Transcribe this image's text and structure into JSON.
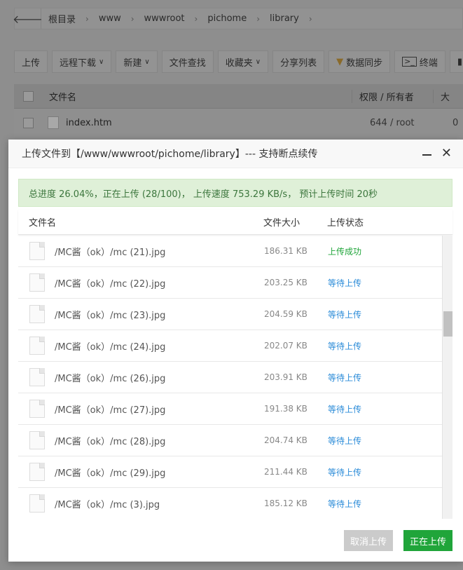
{
  "pathbar": {
    "back_icon": "arrow-left-icon",
    "crumbs": [
      "根目录",
      "www",
      "wwwroot",
      "pichome",
      "library"
    ]
  },
  "toolbar": {
    "upload": "上传",
    "remote_download": "远程下载",
    "new": "新建",
    "file_search": "文件查找",
    "favorites": "收藏夹",
    "share_list": "分享列表",
    "data_sync": "数据同步",
    "terminal": "终端",
    "more": "/"
  },
  "file_table": {
    "headers": {
      "name": "文件名",
      "perm": "权限 / 所有者",
      "size": "大"
    },
    "rows": [
      {
        "name": "index.htm",
        "perm": "644 / root",
        "size": "0"
      }
    ]
  },
  "modal": {
    "title": "上传文件到【/www/wwwroot/pichome/library】--- 支持断点续传",
    "progress": "总进度 26.04%，正在上传 (28/100)，  上传速度 753.29 KB/s，    预计上传时间 20秒",
    "progress_percent": 26.04,
    "headers": {
      "name": "文件名",
      "size": "文件大小",
      "status": "上传状态"
    },
    "files": [
      {
        "name": "/MC酱（ok）/mc (21).jpg",
        "size": "186.31 KB",
        "status": "上传成功",
        "state": "ok"
      },
      {
        "name": "/MC酱（ok）/mc (22).jpg",
        "size": "203.25 KB",
        "status": "等待上传",
        "state": "wait"
      },
      {
        "name": "/MC酱（ok）/mc (23).jpg",
        "size": "204.59 KB",
        "status": "等待上传",
        "state": "wait"
      },
      {
        "name": "/MC酱（ok）/mc (24).jpg",
        "size": "202.07 KB",
        "status": "等待上传",
        "state": "wait"
      },
      {
        "name": "/MC酱（ok）/mc (26).jpg",
        "size": "203.91 KB",
        "status": "等待上传",
        "state": "wait"
      },
      {
        "name": "/MC酱（ok）/mc (27).jpg",
        "size": "191.38 KB",
        "status": "等待上传",
        "state": "wait"
      },
      {
        "name": "/MC酱（ok）/mc (28).jpg",
        "size": "204.74 KB",
        "status": "等待上传",
        "state": "wait"
      },
      {
        "name": "/MC酱（ok）/mc (29).jpg",
        "size": "211.44 KB",
        "status": "等待上传",
        "state": "wait"
      },
      {
        "name": "/MC酱（ok）/mc (3).jpg",
        "size": "185.12 KB",
        "status": "等待上传",
        "state": "wait"
      }
    ],
    "cancel_label": "取消上传",
    "uploading_label": "正在上传"
  },
  "colors": {
    "success": "#20a53a",
    "waiting": "#2a8bd8",
    "progress_bg": "#dff0d8",
    "progress_text": "#3c763d"
  }
}
